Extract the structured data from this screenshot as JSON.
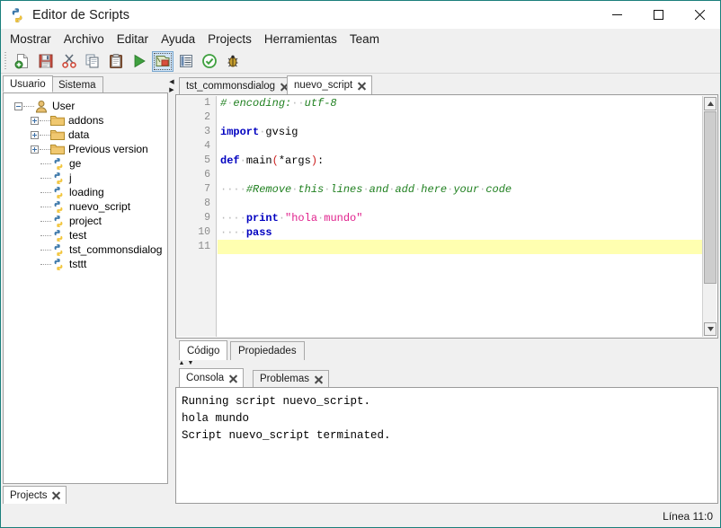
{
  "window": {
    "title": "Editor de Scripts",
    "app_icon": "python-icon",
    "controls": {
      "minimize_label": "—",
      "maximize_label": "□",
      "close_label": "✕"
    },
    "border_color": "#1b7f7c"
  },
  "menubar": {
    "items": [
      {
        "label": "Mostrar"
      },
      {
        "label": "Archivo"
      },
      {
        "label": "Editar"
      },
      {
        "label": "Ayuda"
      },
      {
        "label": "Projects"
      },
      {
        "label": "Herramientas"
      },
      {
        "label": "Team"
      }
    ]
  },
  "toolbar": {
    "buttons": [
      {
        "name": "new-script-icon",
        "tooltip": "Nuevo",
        "selected": false
      },
      {
        "name": "save-icon",
        "tooltip": "Guardar",
        "selected": false
      },
      {
        "name": "cut-icon",
        "tooltip": "Cortar",
        "selected": false
      },
      {
        "name": "copy-icon",
        "tooltip": "Copiar",
        "selected": false
      },
      {
        "name": "paste-icon",
        "tooltip": "Pegar",
        "selected": false
      },
      {
        "name": "run-icon",
        "tooltip": "Ejecutar",
        "selected": false
      },
      {
        "name": "run-external-icon",
        "tooltip": "Ejecutar externo",
        "selected": true
      },
      {
        "name": "properties-icon",
        "tooltip": "Propiedades",
        "selected": false
      },
      {
        "name": "check-icon",
        "tooltip": "Validar",
        "selected": false
      },
      {
        "name": "debug-bug-icon",
        "tooltip": "Depurar",
        "selected": false
      }
    ]
  },
  "left_panel": {
    "tabs": [
      {
        "label": "Usuario",
        "active": true
      },
      {
        "label": "Sistema",
        "active": false
      }
    ],
    "tree": [
      {
        "label": "User",
        "icon": "user-icon",
        "depth": 0,
        "expander": "minus"
      },
      {
        "label": "addons",
        "icon": "folder-icon",
        "depth": 1,
        "expander": "plus"
      },
      {
        "label": "data",
        "icon": "folder-icon",
        "depth": 1,
        "expander": "plus"
      },
      {
        "label": "Previous version",
        "icon": "folder-icon",
        "depth": 1,
        "expander": "plus"
      },
      {
        "label": "ge",
        "icon": "python-file-icon",
        "depth": 1,
        "expander": "none"
      },
      {
        "label": "j",
        "icon": "python-file-icon",
        "depth": 1,
        "expander": "none"
      },
      {
        "label": "loading",
        "icon": "python-file-icon",
        "depth": 1,
        "expander": "none"
      },
      {
        "label": "nuevo_script",
        "icon": "python-file-icon",
        "depth": 1,
        "expander": "none"
      },
      {
        "label": "project",
        "icon": "python-file-icon",
        "depth": 1,
        "expander": "none"
      },
      {
        "label": "test",
        "icon": "python-file-icon",
        "depth": 1,
        "expander": "none"
      },
      {
        "label": "tst_commonsdialog",
        "icon": "python-file-icon",
        "depth": 1,
        "expander": "none"
      },
      {
        "label": "tsttt",
        "icon": "python-file-icon",
        "depth": 1,
        "expander": "none"
      }
    ],
    "bottom_tab": {
      "label": "Projects",
      "closable": true
    }
  },
  "editor": {
    "tabs": [
      {
        "label": "tst_commonsdialog",
        "active": false,
        "closable": true
      },
      {
        "label": "nuevo_script",
        "active": true,
        "closable": true
      }
    ],
    "line_numbers": [
      "1",
      "2",
      "3",
      "4",
      "5",
      "6",
      "7",
      "8",
      "9",
      "10",
      "11"
    ],
    "current_line": 11,
    "lines": [
      {
        "n": 1,
        "tokens": [
          {
            "t": "#",
            "c": "com"
          },
          {
            "t": "·",
            "c": "ws"
          },
          {
            "t": "encoding:",
            "c": "com"
          },
          {
            "t": "··",
            "c": "ws"
          },
          {
            "t": "utf-8",
            "c": "com"
          }
        ]
      },
      {
        "n": 2,
        "tokens": []
      },
      {
        "n": 3,
        "tokens": [
          {
            "t": "import",
            "c": "kw"
          },
          {
            "t": "·",
            "c": "ws"
          },
          {
            "t": "gvsig",
            "c": "plain"
          }
        ]
      },
      {
        "n": 4,
        "tokens": []
      },
      {
        "n": 5,
        "tokens": [
          {
            "t": "def",
            "c": "kw"
          },
          {
            "t": "·",
            "c": "ws"
          },
          {
            "t": "main",
            "c": "plain"
          },
          {
            "t": "(",
            "c": "pun"
          },
          {
            "t": "*args",
            "c": "plain"
          },
          {
            "t": ")",
            "c": "pun"
          },
          {
            "t": ":",
            "c": "plain"
          }
        ]
      },
      {
        "n": 6,
        "tokens": []
      },
      {
        "n": 7,
        "tokens": [
          {
            "t": "····",
            "c": "ws"
          },
          {
            "t": "#Remove",
            "c": "com"
          },
          {
            "t": "·",
            "c": "ws"
          },
          {
            "t": "this",
            "c": "com"
          },
          {
            "t": "·",
            "c": "ws"
          },
          {
            "t": "lines",
            "c": "com"
          },
          {
            "t": "·",
            "c": "ws"
          },
          {
            "t": "and",
            "c": "com"
          },
          {
            "t": "·",
            "c": "ws"
          },
          {
            "t": "add",
            "c": "com"
          },
          {
            "t": "·",
            "c": "ws"
          },
          {
            "t": "here",
            "c": "com"
          },
          {
            "t": "·",
            "c": "ws"
          },
          {
            "t": "your",
            "c": "com"
          },
          {
            "t": "·",
            "c": "ws"
          },
          {
            "t": "code",
            "c": "com"
          }
        ]
      },
      {
        "n": 8,
        "tokens": []
      },
      {
        "n": 9,
        "tokens": [
          {
            "t": "····",
            "c": "ws"
          },
          {
            "t": "print",
            "c": "kw"
          },
          {
            "t": "·",
            "c": "ws"
          },
          {
            "t": "\"hola",
            "c": "str"
          },
          {
            "t": "·",
            "c": "ws"
          },
          {
            "t": "mundo\"",
            "c": "str"
          }
        ]
      },
      {
        "n": 10,
        "tokens": [
          {
            "t": "····",
            "c": "ws"
          },
          {
            "t": "pass",
            "c": "kw"
          }
        ]
      },
      {
        "n": 11,
        "tokens": []
      }
    ],
    "highlight_color": "#ffffb0",
    "bottom_tabs": [
      {
        "label": "Código",
        "active": true
      },
      {
        "label": "Propiedades",
        "active": false
      }
    ],
    "scrollbar": {
      "up_arrow": "▲",
      "down_arrow": "▼"
    }
  },
  "console": {
    "tabs": [
      {
        "label": "Consola",
        "active": true,
        "closable": true
      },
      {
        "label": "Problemas",
        "active": false,
        "closable": true
      }
    ],
    "output": "Running script nuevo_script.\nhola mundo\nScript nuevo_script terminated."
  },
  "statusbar": {
    "text": "Línea 11:0"
  }
}
